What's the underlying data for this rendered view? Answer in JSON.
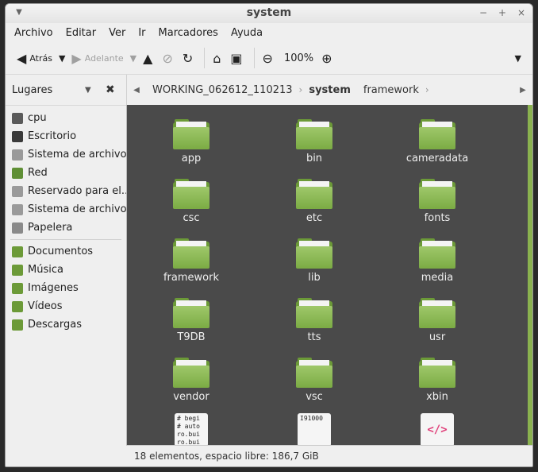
{
  "window": {
    "title": "system"
  },
  "menu": [
    "Archivo",
    "Editar",
    "Ver",
    "Ir",
    "Marcadores",
    "Ayuda"
  ],
  "toolbar": {
    "back_label": "Atrás",
    "forward_label": "Adelante",
    "zoom": "100%"
  },
  "sidebar": {
    "title": "Lugares",
    "items": [
      {
        "label": "cpu",
        "icon": "home-icon",
        "color": "#5a5a5a"
      },
      {
        "label": "Escritorio",
        "icon": "desktop-icon",
        "color": "#3a3a3a"
      },
      {
        "label": "Sistema de archivo...",
        "icon": "drive-icon",
        "color": "#9a9a9a"
      },
      {
        "label": "Red",
        "icon": "network-icon",
        "color": "#5f8f35"
      },
      {
        "label": "Reservado para el...",
        "icon": "drive-icon",
        "color": "#9a9a9a"
      },
      {
        "label": "Sistema de archivo...",
        "icon": "drive-icon",
        "color": "#9a9a9a"
      },
      {
        "label": "Papelera",
        "icon": "trash-icon",
        "color": "#8a8a8a"
      }
    ],
    "bookmarks": [
      {
        "label": "Documentos",
        "icon": "documents-icon",
        "color": "#6c9a38"
      },
      {
        "label": "Música",
        "icon": "music-icon",
        "color": "#6c9a38"
      },
      {
        "label": "Imágenes",
        "icon": "pictures-icon",
        "color": "#6c9a38"
      },
      {
        "label": "Vídeos",
        "icon": "videos-icon",
        "color": "#6c9a38"
      },
      {
        "label": "Descargas",
        "icon": "downloads-icon",
        "color": "#6c9a38"
      }
    ]
  },
  "path": {
    "crumbs": [
      "WORKING_062612_110213",
      "system",
      "framework"
    ],
    "active_index": 1
  },
  "files": [
    {
      "name": "app",
      "type": "folder"
    },
    {
      "name": "bin",
      "type": "folder"
    },
    {
      "name": "cameradata",
      "type": "folder"
    },
    {
      "name": "csc",
      "type": "folder"
    },
    {
      "name": "etc",
      "type": "folder"
    },
    {
      "name": "fonts",
      "type": "folder"
    },
    {
      "name": "framework",
      "type": "folder"
    },
    {
      "name": "lib",
      "type": "folder"
    },
    {
      "name": "media",
      "type": "folder"
    },
    {
      "name": "T9DB",
      "type": "folder"
    },
    {
      "name": "tts",
      "type": "folder"
    },
    {
      "name": "usr",
      "type": "folder"
    },
    {
      "name": "vendor",
      "type": "folder"
    },
    {
      "name": "vsc",
      "type": "folder"
    },
    {
      "name": "xbin",
      "type": "folder"
    },
    {
      "name": "",
      "type": "text",
      "preview": "# begi\n# auto\nro.bui\nro.bui"
    },
    {
      "name": "",
      "type": "text",
      "preview": "I91000"
    },
    {
      "name": "",
      "type": "code",
      "preview": "</>"
    }
  ],
  "status": "18 elementos, espacio libre: 186,7 GiB"
}
